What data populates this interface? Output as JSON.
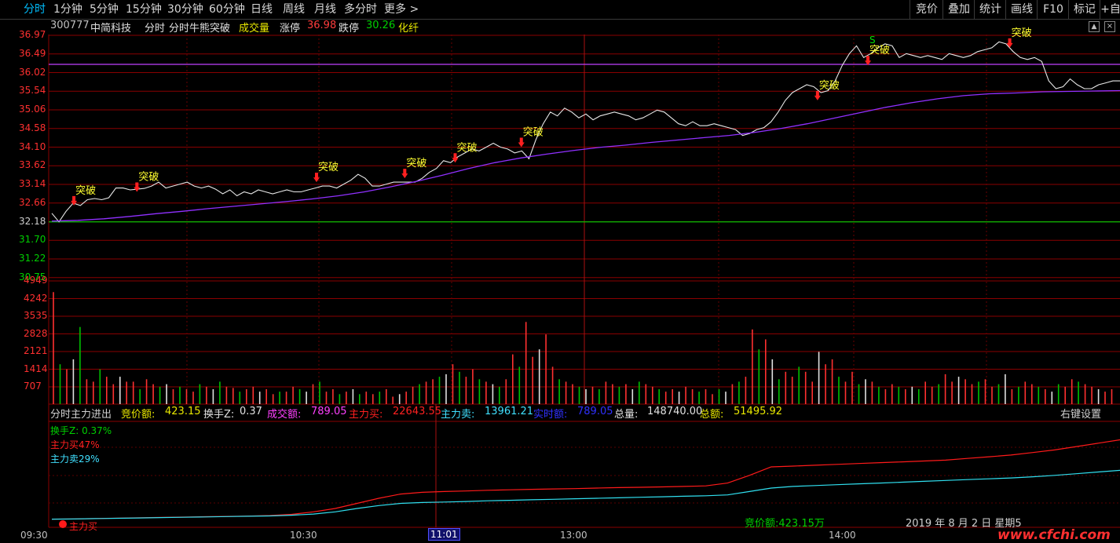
{
  "tabs": [
    "分时",
    "1分钟",
    "5分钟",
    "15分钟",
    "30分钟",
    "60分钟",
    "日线",
    "周线",
    "月线",
    "多分时",
    "更多 >"
  ],
  "right_tabs": [
    "竞价",
    "叠加",
    "统计",
    "画线",
    "F10",
    "标记",
    "+自"
  ],
  "stock": {
    "code": "300777",
    "name": "中简科技",
    "indicator": "分时",
    "indicator2": "分时牛熊突破",
    "volume_label": "成交量",
    "limit_up_label": "涨停",
    "limit_up": "36.98",
    "limit_down_label": "跌停",
    "limit_down": "30.26",
    "industry": "化纤"
  },
  "price_axis": [
    "36.97",
    "36.49",
    "36.02",
    "35.54",
    "35.06",
    "34.58",
    "34.10",
    "33.62",
    "33.14",
    "32.66",
    "32.18",
    "31.70",
    "31.22",
    "30.75"
  ],
  "volume_axis": [
    "4949",
    "4242",
    "3535",
    "2828",
    "2121",
    "1414",
    "707"
  ],
  "signal_label": "突破",
  "signal_s": "S",
  "lower_header": {
    "title": "分时主力进出",
    "bid_amt_label": "竞价额:",
    "bid_amt": "423.15",
    "turnover_label": "换手Z:",
    "turnover": "0.37",
    "deal_amt_label": "成交额:",
    "deal_amt": "789.05",
    "main_buy_label": "主力买:",
    "main_buy": "22643.55",
    "main_sell_label": "主力卖:",
    "main_sell": "13961.21",
    "realtime_label": "实时额:",
    "realtime": "789.05",
    "total_vol_label": "总量:",
    "total_vol": "148740.00",
    "total_amt_label": "总额:",
    "total_amt": "51495.92",
    "settings": "右键设置"
  },
  "legend": {
    "turnover": "换手Z: 0.37%",
    "buy": "主力买47%",
    "sell": "主力卖29%"
  },
  "bid_text": "竞价额:423.15万",
  "date_text": "2019 年 8 月 2 日 星期5",
  "main_buy_marker": "主力买",
  "time_axis": [
    "09:30",
    "10:30",
    "11:01",
    "13:00",
    "14:00"
  ],
  "watermark": "www.cfchi.com",
  "chart_data": {
    "type": "line",
    "title": "300777 中简科技 分时",
    "ylim": [
      30.75,
      36.97
    ],
    "prev_close": 32.18,
    "price_series": [
      32.4,
      32.18,
      32.45,
      32.66,
      32.6,
      32.75,
      32.78,
      32.75,
      32.8,
      33.05,
      33.05,
      33.0,
      33.02,
      33.04,
      33.1,
      33.2,
      33.05,
      33.1,
      33.15,
      33.2,
      33.1,
      33.05,
      33.1,
      33.02,
      32.9,
      33.0,
      32.85,
      32.95,
      32.9,
      33.0,
      32.95,
      32.9,
      32.95,
      33.0,
      32.95,
      32.95,
      33.0,
      33.05,
      33.1,
      33.1,
      33.05,
      33.15,
      33.25,
      33.4,
      33.3,
      33.1,
      33.1,
      33.15,
      33.2,
      33.2,
      33.2,
      33.2,
      33.3,
      33.45,
      33.55,
      33.75,
      33.7,
      33.85,
      33.95,
      34.05,
      34.0,
      34.1,
      34.2,
      34.1,
      34.05,
      33.95,
      34.0,
      33.8,
      34.3,
      34.7,
      35.0,
      34.9,
      35.1,
      35.0,
      34.85,
      34.95,
      34.8,
      34.9,
      34.95,
      35.0,
      34.95,
      34.9,
      34.8,
      34.85,
      34.95,
      35.05,
      35.0,
      34.85,
      34.7,
      34.65,
      34.75,
      34.65,
      34.65,
      34.7,
      34.65,
      34.6,
      34.55,
      34.4,
      34.45,
      34.55,
      34.6,
      34.75,
      35.0,
      35.3,
      35.5,
      35.6,
      35.7,
      35.65,
      35.5,
      35.55,
      35.8,
      36.2,
      36.5,
      36.7,
      36.4,
      36.5,
      36.65,
      36.75,
      36.7,
      36.4,
      36.5,
      36.45,
      36.4,
      36.45,
      36.4,
      36.35,
      36.5,
      36.45,
      36.4,
      36.45,
      36.55,
      36.6,
      36.65,
      36.8,
      36.75,
      36.55,
      36.4,
      36.35,
      36.4,
      36.3,
      35.8,
      35.6,
      35.65,
      35.85,
      35.7,
      35.6,
      35.6,
      35.7,
      35.75,
      35.8,
      35.8
    ],
    "avg_series": [
      32.2,
      32.22,
      32.26,
      32.32,
      32.39,
      32.45,
      32.52,
      32.58,
      32.64,
      32.7,
      32.77,
      32.85,
      32.95,
      33.08,
      33.22,
      33.38,
      33.55,
      33.7,
      33.82,
      33.92,
      34.01,
      34.09,
      34.15,
      34.22,
      34.28,
      34.34,
      34.4,
      34.48,
      34.58,
      34.7,
      34.84,
      34.98,
      35.12,
      35.24,
      35.34,
      35.42,
      35.47,
      35.49,
      35.52,
      35.53,
      35.54,
      35.55
    ],
    "signals": [
      {
        "x": 7,
        "y": 32.6
      },
      {
        "x": 27,
        "y": 32.95
      },
      {
        "x": 84,
        "y": 33.2
      },
      {
        "x": 112,
        "y": 33.3
      },
      {
        "x": 128,
        "y": 33.7
      },
      {
        "x": 149,
        "y": 34.1
      },
      {
        "x": 243,
        "y": 35.3
      },
      {
        "x": 259,
        "y": 36.2
      },
      {
        "x": 304,
        "y": 36.65
      }
    ],
    "volume": [
      4500,
      1600,
      1400,
      1800,
      3100,
      1000,
      900,
      1400,
      1100,
      800,
      1100,
      900,
      900,
      600,
      1000,
      800,
      700,
      800,
      600,
      700,
      600,
      500,
      800,
      700,
      600,
      900,
      700,
      650,
      500,
      600,
      700,
      500,
      600,
      400,
      500,
      500,
      700,
      600,
      500,
      800,
      900,
      500,
      600,
      400,
      500,
      600,
      400,
      500,
      400,
      500,
      600,
      300,
      400,
      500,
      700,
      800,
      900,
      1000,
      1100,
      1200,
      1600,
      1300,
      1100,
      1400,
      1000,
      900,
      800,
      700,
      1000,
      2000,
      1500,
      3300,
      1900,
      2200,
      2800,
      1500,
      1000,
      900,
      800,
      700,
      600,
      700,
      600,
      900,
      800,
      700,
      800,
      600,
      900,
      800,
      700,
      600,
      500,
      600,
      500,
      700,
      600,
      500,
      600,
      400,
      600,
      500,
      800,
      900,
      1100,
      3000,
      2200,
      2600,
      1800,
      1000,
      1300,
      1100,
      1500,
      1300,
      900,
      2100,
      1600,
      1800,
      1100,
      900,
      1300,
      800,
      1000,
      900,
      700,
      600,
      800,
      700,
      600,
      700,
      600,
      900,
      700,
      800,
      1200,
      900,
      1100,
      1000,
      800,
      900,
      1000,
      700,
      800,
      1200,
      600,
      700,
      900,
      800,
      700,
      600,
      500,
      800,
      700,
      1000,
      900,
      800,
      700,
      600,
      500,
      600
    ],
    "main_buy_pct": [
      0.2,
      0.3,
      0.5,
      0.8,
      1.0,
      1.2,
      1.4,
      1.6,
      1.8,
      2.0,
      2.3,
      3.0,
      4.5,
      6.5,
      9.5,
      12.5,
      15.0,
      16.0,
      16.5,
      16.8,
      17.2,
      17.5,
      17.8,
      18.0,
      18.2,
      18.5,
      18.8,
      19.0,
      19.2,
      19.5,
      19.8,
      21.5,
      26.0,
      31.0,
      31.5,
      32.0,
      32.5,
      33.0,
      33.5,
      34.0,
      34.5,
      35.0,
      36.0,
      37.0,
      38.0,
      39.5,
      41.0,
      43.0,
      45.0,
      47.0
    ],
    "main_sell_pct": [
      0.2,
      0.3,
      0.5,
      0.7,
      0.9,
      1.1,
      1.3,
      1.5,
      1.7,
      1.9,
      2.1,
      2.5,
      3.2,
      4.5,
      6.5,
      8.2,
      9.5,
      10.0,
      10.3,
      10.6,
      11.0,
      11.3,
      11.6,
      11.9,
      12.2,
      12.5,
      12.8,
      13.1,
      13.4,
      13.7,
      14.0,
      14.5,
      16.5,
      18.5,
      19.5,
      20.0,
      20.5,
      21.0,
      21.5,
      22.0,
      22.5,
      23.0,
      23.5,
      24.0,
      24.5,
      25.2,
      26.0,
      27.0,
      28.0,
      29.0
    ]
  }
}
